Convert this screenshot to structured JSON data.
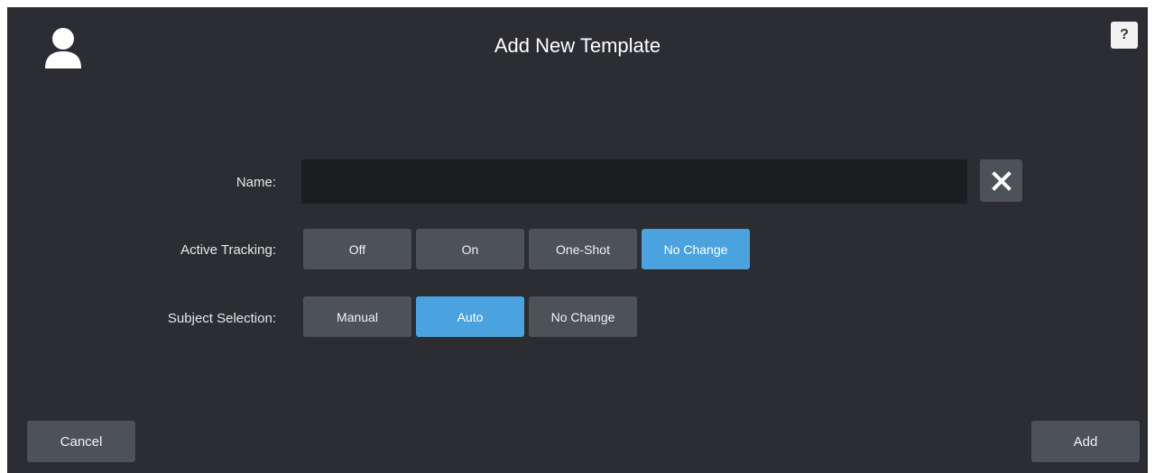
{
  "header": {
    "title": "Add New Template",
    "user_icon": "user-icon",
    "help_label": "?"
  },
  "form": {
    "name": {
      "label": "Name:",
      "value": "",
      "placeholder": "",
      "clear_icon": "close-icon"
    },
    "active_tracking": {
      "label": "Active Tracking:",
      "options": [
        "Off",
        "On",
        "One-Shot",
        "No Change"
      ],
      "selected": "No Change"
    },
    "subject_selection": {
      "label": "Subject Selection:",
      "options": [
        "Manual",
        "Auto",
        "No Change"
      ],
      "selected": "Auto"
    }
  },
  "footer": {
    "cancel_label": "Cancel",
    "add_label": "Add"
  },
  "colors": {
    "background": "#2b2d32",
    "button": "#4d5158",
    "accent": "#4aa3df",
    "input": "#1c1d20"
  }
}
